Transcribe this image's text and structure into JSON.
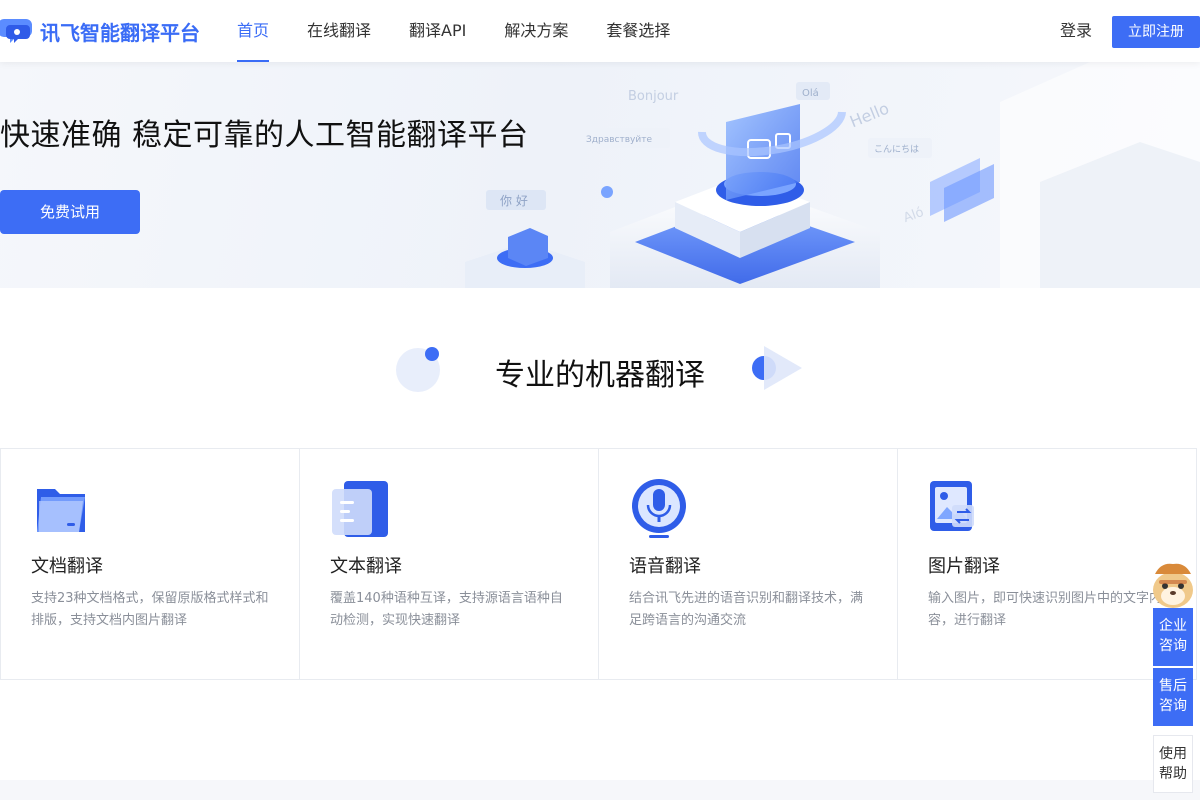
{
  "header": {
    "logo_text": "讯飞智能翻译平台",
    "nav": [
      {
        "label": "首页",
        "active": true
      },
      {
        "label": "在线翻译",
        "active": false
      },
      {
        "label": "翻译API",
        "active": false
      },
      {
        "label": "解决方案",
        "active": false
      },
      {
        "label": "套餐选择",
        "active": false
      }
    ],
    "login_label": "登录",
    "register_label": "立即注册"
  },
  "hero": {
    "title": "快速准确 稳定可靠的人工智能翻译平台",
    "cta_label": "免费试用",
    "bubbles": [
      "Bonjour",
      "Здравствуйте",
      "你 好",
      "Hello",
      "こんにちは",
      "Olá",
      "Aló"
    ]
  },
  "section": {
    "title": "专业的机器翻译"
  },
  "cards": [
    {
      "icon": "document-folder-icon",
      "title": "文档翻译",
      "desc": "支持23种文档格式，保留原版格式样式和排版，支持文档内图片翻译"
    },
    {
      "icon": "text-document-icon",
      "title": "文本翻译",
      "desc": "覆盖140种语种互译，支持源语言语种自动检测，实现快速翻译"
    },
    {
      "icon": "microphone-icon",
      "title": "语音翻译",
      "desc": "结合讯飞先进的语音识别和翻译技术，满足跨语言的沟通交流"
    },
    {
      "icon": "image-translate-icon",
      "title": "图片翻译",
      "desc": "输入图片，即可快速识别图片中的文字内容，进行翻译"
    }
  ],
  "float_widget": {
    "enterprise_label": "企业咨询",
    "aftersale_label": "售后咨询",
    "help_label": "使用帮助"
  },
  "colors": {
    "accent": "#3d6df5",
    "text_muted": "#8a8f99"
  }
}
